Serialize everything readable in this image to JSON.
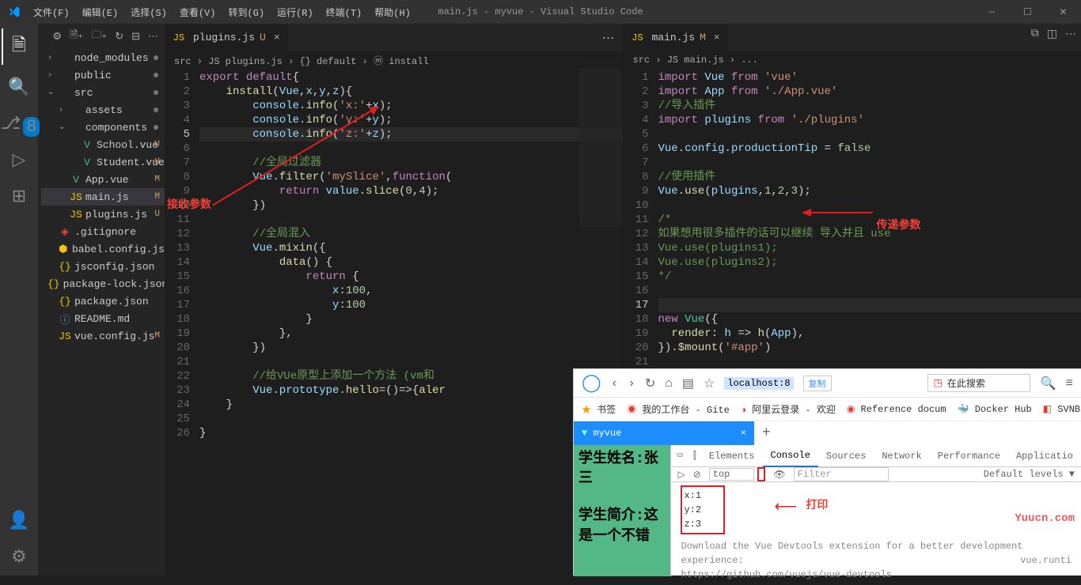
{
  "window": {
    "title": "main.js - myvue - Visual Studio Code"
  },
  "menu": [
    "文件(F)",
    "编辑(E)",
    "选择(S)",
    "查看(V)",
    "转到(G)",
    "运行(R)",
    "终端(T)",
    "帮助(H)"
  ],
  "activity_badge": "8",
  "explorer": {
    "toolbar": [
      "⚙",
      "⤵",
      "⤴",
      "↻",
      "⋯"
    ],
    "items": [
      {
        "indent": 8,
        "chev": "›",
        "icon": "",
        "name": "node_modules",
        "color": "c-folder",
        "stat": "dot"
      },
      {
        "indent": 8,
        "chev": "›",
        "icon": "",
        "name": "public",
        "color": "c-folder",
        "stat": "dot"
      },
      {
        "indent": 8,
        "chev": "⌄",
        "icon": "",
        "name": "src",
        "color": "c-folder",
        "stat": "dot"
      },
      {
        "indent": 22,
        "chev": "›",
        "icon": "",
        "name": "assets",
        "color": "c-folder",
        "stat": "dot"
      },
      {
        "indent": 22,
        "chev": "⌄",
        "icon": "",
        "name": "components",
        "color": "c-folder",
        "stat": "dot"
      },
      {
        "indent": 36,
        "chev": "",
        "icon": "V",
        "name": "School.vue",
        "color": "c-vue",
        "stat": "U"
      },
      {
        "indent": 36,
        "chev": "",
        "icon": "V",
        "name": "Student.vue",
        "color": "c-vue",
        "stat": "U"
      },
      {
        "indent": 22,
        "chev": "",
        "icon": "V",
        "name": "App.vue",
        "color": "c-vue",
        "stat": "M"
      },
      {
        "indent": 22,
        "chev": "",
        "icon": "JS",
        "name": "main.js",
        "color": "c-js",
        "stat": "M",
        "sel": true
      },
      {
        "indent": 22,
        "chev": "",
        "icon": "JS",
        "name": "plugins.js",
        "color": "c-js",
        "stat": "U"
      },
      {
        "indent": 8,
        "chev": "",
        "icon": "◈",
        "name": ".gitignore",
        "color": "c-git"
      },
      {
        "indent": 8,
        "chev": "",
        "icon": "⬢",
        "name": "babel.config.js",
        "color": "c-babel"
      },
      {
        "indent": 8,
        "chev": "",
        "icon": "{}",
        "name": "jsconfig.json",
        "color": "c-json"
      },
      {
        "indent": 8,
        "chev": "",
        "icon": "{}",
        "name": "package-lock.json",
        "color": "c-json"
      },
      {
        "indent": 8,
        "chev": "",
        "icon": "{}",
        "name": "package.json",
        "color": "c-json"
      },
      {
        "indent": 8,
        "chev": "",
        "icon": "ⓘ",
        "name": "README.md",
        "color": "c-md"
      },
      {
        "indent": 8,
        "chev": "",
        "icon": "JS",
        "name": "vue.config.js",
        "color": "c-js",
        "stat": "M"
      }
    ]
  },
  "left": {
    "tab": {
      "icon": "JS",
      "name": "plugins.js",
      "mod": "U"
    },
    "crumbs": "src › JS plugins.js › {} default › ⓜ install",
    "lines": [
      "1",
      "2",
      "3",
      "4",
      "5",
      "6",
      "7",
      "8",
      "9",
      "10",
      "11",
      "12",
      "13",
      "14",
      "15",
      "16",
      "17",
      "18",
      "19",
      "20",
      "21",
      "22",
      "23",
      "24",
      "25",
      "26"
    ],
    "code": [
      "<span class='kw'>export</span> <span class='kw'>default</span>{",
      "    <span class='fn'>install</span>(<span class='var'>Vue</span>,<span class='var'>x</span>,<span class='var'>y</span>,<span class='var'>z</span>){",
      "        <span class='var'>console</span>.<span class='fn'>info</span>(<span class='str'>'x:'</span>+<span class='var'>x</span>);",
      "        <span class='var'>console</span>.<span class='fn'>info</span>(<span class='str'>'y:'</span>+<span class='var'>y</span>);",
      "        <span class='var'>console</span>.<span class='fn'>info</span>(<span class='str'>'z:'</span>+<span class='var'>z</span>);",
      "",
      "        <span class='cm'>//全局过滤器</span>",
      "        <span class='var'>Vue</span>.<span class='fn'>filter</span>(<span class='str'>'mySlice'</span>,<span class='kw'>function</span>(",
      "            <span class='kw'>return</span> <span class='var'>value</span>.<span class='fn'>slice</span>(<span class='num'>0</span>,<span class='num'>4</span>);",
      "        })",
      "",
      "        <span class='cm'>//全局混入</span>",
      "        <span class='var'>Vue</span>.<span class='fn'>mixin</span>({",
      "            <span class='fn'>data</span>() {",
      "                <span class='kw'>return</span> {",
      "                    <span class='prop'>x</span>:<span class='num'>100</span>,",
      "                    <span class='prop'>y</span>:<span class='num'>100</span>",
      "                }",
      "            },",
      "        })",
      "",
      "        <span class='cm'>//给VUe原型上添加一个方法 (vm和</span>",
      "        <span class='var'>Vue</span>.<span class='prop'>prototype</span>.<span class='fn'>hello</span>=()=&gt;{<span class='fn'>aler</span>",
      "    }",
      "",
      "}"
    ],
    "anno": "接收参数"
  },
  "right": {
    "tab": {
      "icon": "JS",
      "name": "main.js",
      "mod": "M"
    },
    "crumbs": "src › JS main.js › ...",
    "lines": [
      "1",
      "2",
      "3",
      "4",
      "5",
      "6",
      "7",
      "8",
      "9",
      "10",
      "11",
      "12",
      "13",
      "14",
      "15",
      "16",
      "17",
      "18",
      "19",
      "20",
      "21",
      "22",
      "23",
      "24"
    ],
    "code": [
      "<span class='kw'>import</span> <span class='var'>Vue</span> <span class='kw'>from</span> <span class='str'>'vue'</span>",
      "<span class='kw'>import</span> <span class='var'>App</span> <span class='kw'>from</span> <span class='str'>'./App.vue'</span>",
      "<span class='cm'>//导入插件</span>",
      "<span class='kw'>import</span> <span class='var'>plugins</span> <span class='kw'>from</span> <span class='str'>'./plugins'</span>",
      "",
      "<span class='var'>Vue</span>.<span class='prop'>config</span>.<span class='prop'>productionTip</span> = <span class='num'>false</span>",
      "",
      "<span class='cm'>//使用插件</span>",
      "<span class='var'>Vue</span>.<span class='fn'>use</span>(<span class='var'>plugins</span>,<span class='num'>1</span>,<span class='num'>2</span>,<span class='num'>3</span>);",
      "",
      "<span class='cm'>/*</span>",
      "<span class='cm'>如果想用很多插件的话可以继续 导入并且 use</span>",
      "<span class='cm'>Vue.use(plugins1);</span>",
      "<span class='cm'>Vue.use(plugins2);</span>",
      "<span class='cm'>*/</span>",
      "",
      "",
      "<span class='kw'>new</span> <span class='obj'>Vue</span>({",
      "  <span class='fn'>render</span>: <span class='var'>h</span> =&gt; <span class='fn'>h</span>(<span class='var'>App</span>),",
      "}).<span class='fn'>$mount</span>(<span class='str'>'#app'</span>)",
      "",
      "",
      "",
      ""
    ],
    "anno": "传递参数"
  },
  "browser": {
    "url": "localhost:8",
    "copy": "复制",
    "search_ph": "在此搜索",
    "bookmarks": [
      "书签",
      "我的工作台 - Gite",
      "阿里云登录 - 欢迎",
      "Reference docum",
      "Docker Hub",
      "SVNBuc"
    ],
    "tab": "myvue",
    "page_text1": "学生姓名:张三",
    "page_text2": "学生简介:这是一个不错",
    "dt_tabs": [
      "Elements",
      "Console",
      "Sources",
      "Network",
      "Performance",
      "Applicatio"
    ],
    "dt_top": "top",
    "dt_filter": "Filter",
    "dt_levels": "Default levels ▼",
    "out": [
      "x:1",
      "y:2",
      "z:3"
    ],
    "anno": "打印",
    "footer1": "Download the Vue Devtools extension for a better development",
    "footer1b": "vue.runti",
    "footer2": "experience:",
    "footer3": "https://github.com/vuejs/vue-devtools"
  },
  "watermark": "Yuucn.com"
}
